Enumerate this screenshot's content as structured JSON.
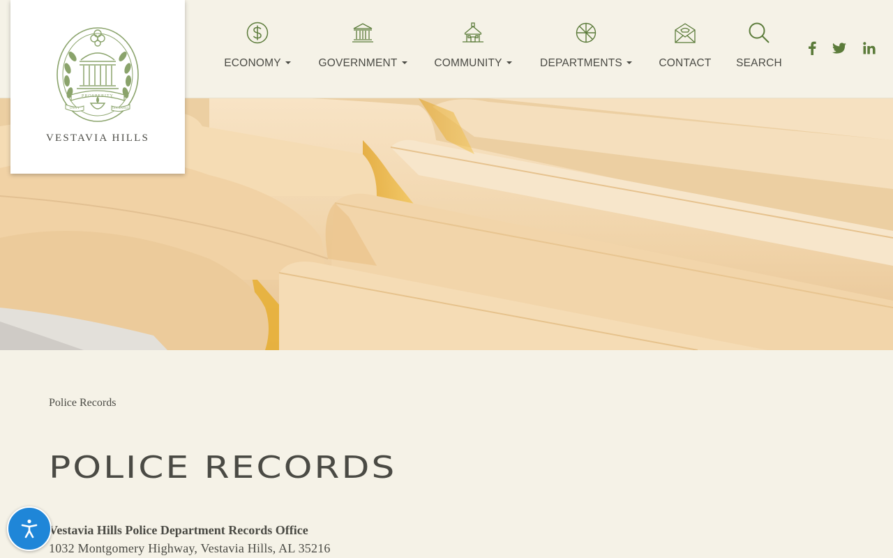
{
  "site": {
    "name": "VESTAVIA HILLS",
    "seal_banner_text": "PROSPERITY",
    "seal_ribbon_left": "UNITY",
    "seal_ribbon_right": "GOODWILL"
  },
  "nav": {
    "items": [
      {
        "label": "ECONOMY",
        "icon": "dollar-icon",
        "has_dropdown": true
      },
      {
        "label": "GOVERNMENT",
        "icon": "government-building-icon",
        "has_dropdown": true
      },
      {
        "label": "COMMUNITY",
        "icon": "community-house-icon",
        "has_dropdown": true
      },
      {
        "label": "DEPARTMENTS",
        "icon": "departments-wheel-icon",
        "has_dropdown": true
      },
      {
        "label": "CONTACT",
        "icon": "phone-envelope-icon",
        "has_dropdown": false
      },
      {
        "label": "SEARCH",
        "icon": "search-icon",
        "has_dropdown": false
      }
    ]
  },
  "social": {
    "facebook": "f",
    "twitter": "twitter-icon",
    "linkedin": "in"
  },
  "hero": {
    "image": "file-folders-photo"
  },
  "breadcrumb": "Police Records",
  "page": {
    "title": "POLICE RECORDS",
    "office_name": "Vestavia Hills Police Department Records Office",
    "office_address": "1032 Montgomery Highway, Vestavia Hills, AL 35216"
  },
  "accessibility_button": {
    "icon": "accessibility-person-icon"
  },
  "colors": {
    "background": "#f5f2e7",
    "text": "#4a4a44",
    "accent_green": "#5b7b3a",
    "logo_green": "#8aa36b",
    "accessibility_blue": "#1f86d8"
  }
}
